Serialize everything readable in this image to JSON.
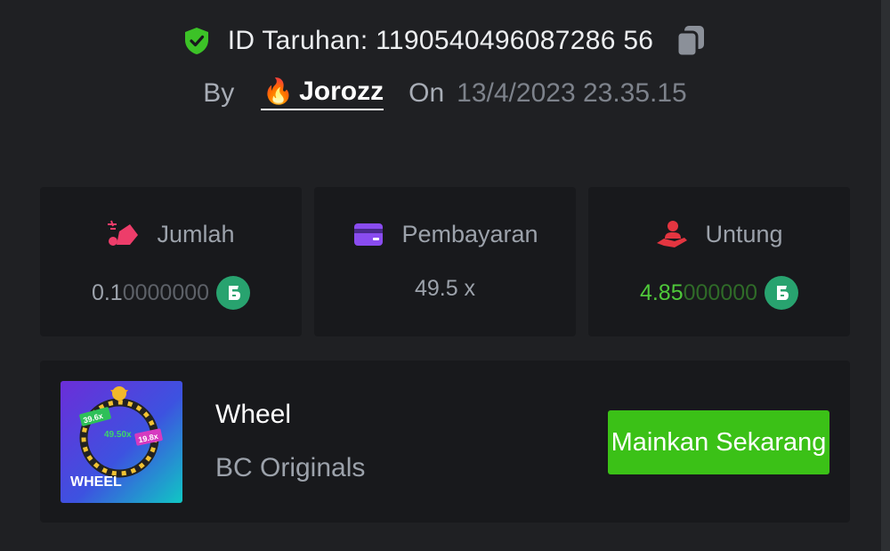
{
  "bet": {
    "id_label": "ID Taruhan: 1190540496087286 56",
    "by_label": "By",
    "username": "Jorozz",
    "on_label": "On",
    "date": "13/4/2023 23.35.15"
  },
  "stats": {
    "amount": {
      "label": "Jumlah",
      "value_main": "0.1",
      "value_dim": "0000000",
      "icon": "bet-coins-icon"
    },
    "payout": {
      "label": "Pembayaran",
      "value": "49.5 x",
      "icon": "wallet-card-icon"
    },
    "profit": {
      "label": "Untung",
      "value_main": "4.85",
      "value_dim": "000000",
      "icon": "hand-profit-icon"
    }
  },
  "game": {
    "thumbnail_title": "WHEEL",
    "thumb_multipliers": [
      "39.6x",
      "49.50x",
      "19.8x"
    ],
    "name": "Wheel",
    "provider": "BC Originals",
    "play_label": "Mainkan Sekarang"
  },
  "colors": {
    "background": "#1f2023",
    "card": "#18191c",
    "accent_green": "#3bc117",
    "profit_green": "#4fc93a",
    "coin": "#28a36f"
  }
}
